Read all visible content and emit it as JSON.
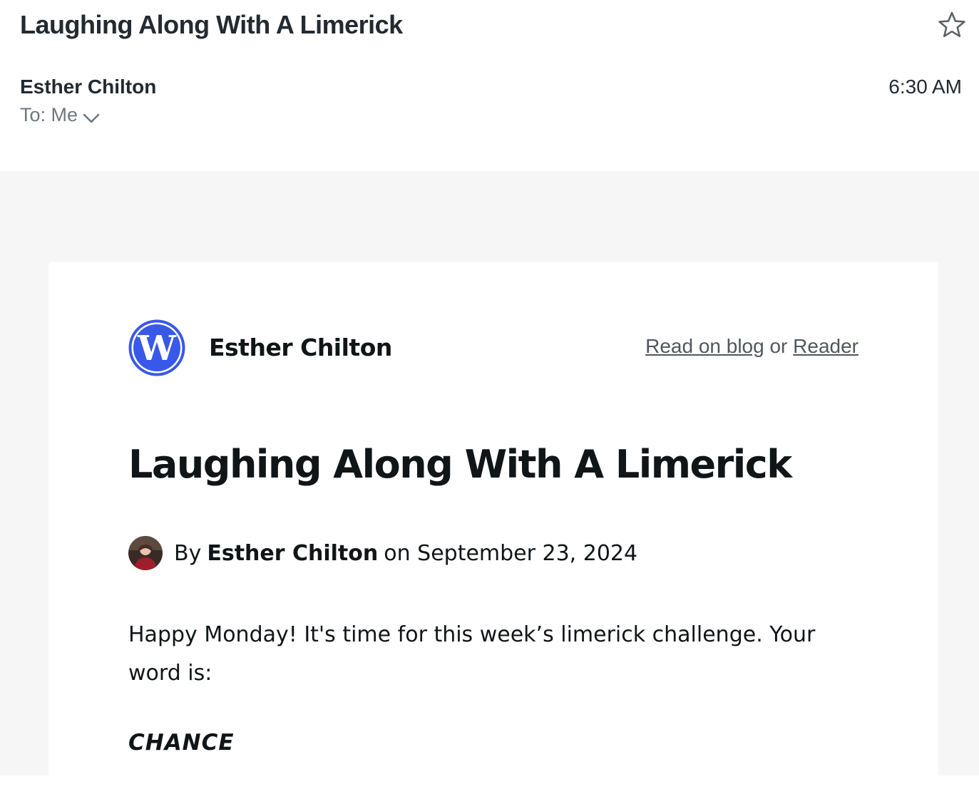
{
  "header": {
    "subject": "Laughing Along With A Limerick",
    "sender": "Esther Chilton",
    "recipient": "To: Me",
    "time": "6:30 AM"
  },
  "card": {
    "blog_name": "Esther Chilton",
    "read_on_blog": "Read on blog",
    "or_text": " or ",
    "reader": "Reader",
    "post_title": "Laughing Along With A Limerick",
    "byline": {
      "by": "By",
      "author": "Esther Chilton",
      "on": "on",
      "date": "September 23, 2024"
    },
    "paragraph": "Happy Monday! It's time for this week’s limerick challenge. Your word is:",
    "challenge_word": "CHANCE"
  },
  "colors": {
    "wordpress_blue": "#3858e9",
    "body_background": "#f6f6f6",
    "link_gray": "#50575e"
  },
  "icons": {
    "star": "star-icon",
    "chevron": "chevron-down-icon",
    "logo": "wordpress-logo-icon"
  }
}
